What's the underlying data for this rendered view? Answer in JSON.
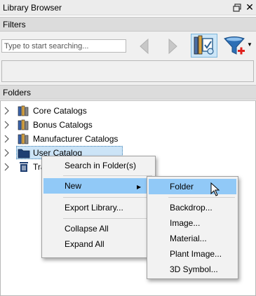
{
  "window": {
    "title": "Library Browser"
  },
  "filters": {
    "header": "Filters",
    "search_placeholder": "Type to start searching..."
  },
  "folders": {
    "header": "Folders",
    "items": [
      {
        "label": "Core Catalogs",
        "icon": "books-icon"
      },
      {
        "label": "Bonus Catalogs",
        "icon": "books-icon"
      },
      {
        "label": "Manufacturer Catalogs",
        "icon": "books-icon"
      },
      {
        "label": "User Catalog",
        "icon": "folder-icon",
        "selected": true
      },
      {
        "label": "Tra",
        "icon": "trash-icon"
      }
    ]
  },
  "context_menu": {
    "items": [
      "Search in Folder(s)",
      "New",
      "Export Library...",
      "Collapse All",
      "Expand All"
    ],
    "highlighted": "New"
  },
  "submenu": {
    "items": [
      "Folder",
      "Backdrop...",
      "Image...",
      "Material...",
      "Plant Image...",
      "3D Symbol..."
    ],
    "highlighted": "Folder"
  },
  "colors": {
    "selection": "#cce4f7",
    "menu_highlight": "#91c9f7",
    "header_bg": "#dcdcdc"
  }
}
